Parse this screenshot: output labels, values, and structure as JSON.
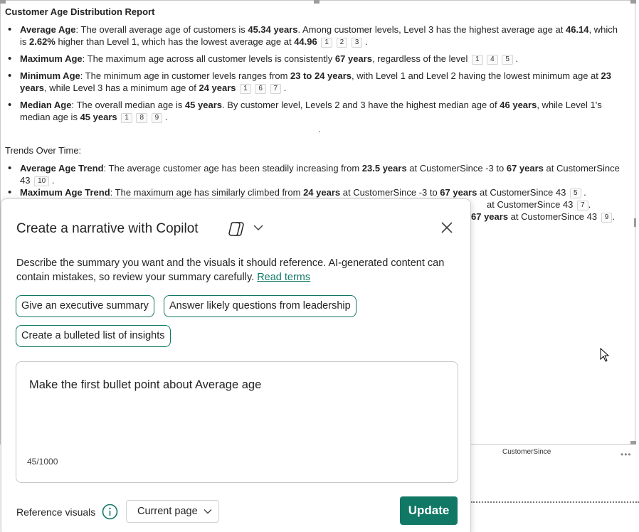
{
  "report": {
    "title": "Customer Age Distribution Report",
    "bullets": [
      {
        "parts": [
          {
            "t": "Average Age",
            "b": true
          },
          {
            "t": ": The overall average age of customers is "
          },
          {
            "t": "45.34 years",
            "b": true
          },
          {
            "t": ". Among customer levels, Level 3 has the highest average age at "
          },
          {
            "t": "46.14",
            "b": true
          },
          {
            "t": ", which is "
          },
          {
            "t": "2.62%",
            "b": true
          },
          {
            "t": " higher than Level 1, which has the lowest average age at "
          },
          {
            "t": "44.96",
            "b": true
          }
        ],
        "refs": [
          "1",
          "2",
          "3"
        ]
      },
      {
        "parts": [
          {
            "t": "Maximum Age",
            "b": true
          },
          {
            "t": ": The maximum age across all customer levels is consistently "
          },
          {
            "t": "67 years",
            "b": true
          },
          {
            "t": ", regardless of the level"
          }
        ],
        "refs": [
          "1",
          "4",
          "5"
        ]
      },
      {
        "parts": [
          {
            "t": "Minimum Age",
            "b": true
          },
          {
            "t": ": The minimum age in customer levels ranges from "
          },
          {
            "t": "23 to 24 years",
            "b": true
          },
          {
            "t": ", with Level 1 and Level 2 having the lowest minimum age at "
          },
          {
            "t": "23 years",
            "b": true
          },
          {
            "t": ", while Level 3 has a minimum age of "
          },
          {
            "t": "24 years",
            "b": true
          }
        ],
        "refs": [
          "1",
          "6",
          "7"
        ]
      },
      {
        "parts": [
          {
            "t": "Median Age",
            "b": true
          },
          {
            "t": ": The overall median age is "
          },
          {
            "t": "45 years",
            "b": true
          },
          {
            "t": ". By customer level, Levels 2 and 3 have the highest median age of "
          },
          {
            "t": "46 years",
            "b": true
          },
          {
            "t": ", while Level 1's median age is "
          },
          {
            "t": "45 years",
            "b": true
          }
        ],
        "refs": [
          "1",
          "8",
          "9"
        ]
      }
    ],
    "trends_label": "Trends Over Time:",
    "trend_bullets": [
      {
        "parts": [
          {
            "t": "Average Age Trend",
            "b": true
          },
          {
            "t": ": The average customer age has been steadily increasing from "
          },
          {
            "t": "23.5 years",
            "b": true
          },
          {
            "t": " at CustomerSince -3 to "
          },
          {
            "t": "67 years",
            "b": true
          },
          {
            "t": " at CustomerSince 43"
          }
        ],
        "refs": [
          "10"
        ]
      },
      {
        "parts": [
          {
            "t": "Maximum Age Trend",
            "b": true
          },
          {
            "t": ": The maximum age has similarly climbed from "
          },
          {
            "t": "24 years",
            "b": true
          },
          {
            "t": " at CustomerSince -3 to "
          },
          {
            "t": "67 years",
            "b": true
          },
          {
            "t": " at CustomerSince 43"
          }
        ],
        "refs": [
          "5"
        ]
      }
    ],
    "partial_line_1": {
      "text": "at CustomerSince 43",
      "ref": "7"
    },
    "partial_line_2": {
      "bold": "67 years",
      "text": " at CustomerSince 43",
      "ref": "9"
    }
  },
  "axis_label": "CustomerSince",
  "more_options": "•••",
  "copilot": {
    "title": "Create a narrative with Copilot",
    "description": "Describe the summary you want and the visuals it should reference. AI-generated content can contain mistakes, so review your summary carefully.",
    "read_terms": "Read terms",
    "suggestions": [
      "Give an executive summary",
      "Answer likely questions from leadership",
      "Create a bulleted list of insights"
    ],
    "prompt_value": "Make the first bullet point about Average age",
    "char_count": "45/1000",
    "reference_visuals_label": "Reference visuals",
    "reference_visuals_value": "Current page",
    "update_label": "Update",
    "accent_color": "#117865"
  }
}
